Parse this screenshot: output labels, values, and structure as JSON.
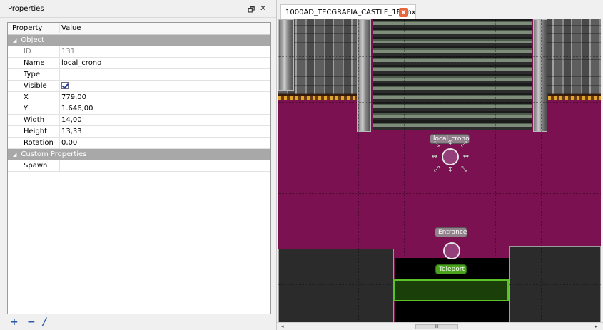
{
  "properties_panel": {
    "title": "Properties",
    "float_glyph": "🗗",
    "close_glyph": "✕",
    "header": {
      "property": "Property",
      "value": "Value"
    },
    "groups": {
      "object": "Object",
      "custom": "Custom Properties"
    },
    "rows": {
      "id": {
        "label": "ID",
        "value": "131"
      },
      "name": {
        "label": "Name",
        "value": "local_crono"
      },
      "type": {
        "label": "Type",
        "value": ""
      },
      "visible": {
        "label": "Visible",
        "checked": true
      },
      "x": {
        "label": "X",
        "value": "779,00"
      },
      "y": {
        "label": "Y",
        "value": "1.646,00"
      },
      "width": {
        "label": "Width",
        "value": "14,00"
      },
      "height": {
        "label": "Height",
        "value": "13,33"
      },
      "rotation": {
        "label": "Rotation",
        "value": "0,00"
      },
      "spawn": {
        "label": "Spawn",
        "value": ""
      }
    },
    "tools": {
      "add": "+",
      "remove": "−",
      "rename": "/"
    }
  },
  "editor": {
    "tab_label": "1000AD_TECGRAFIA_CASTLE_1F.tmx",
    "tab_close": "x",
    "objects": {
      "local_crono": "local_crono",
      "entrance": "Entrance",
      "teleport": "Teleport"
    },
    "scrollbar": {
      "left": "◂",
      "right": "▸",
      "thumb": "III"
    }
  },
  "colors": {
    "floor_carpet": "#7b1150",
    "teleport_green": "#4aa21c",
    "group_header": "#a8a8a8",
    "tab_close": "#e8663c"
  }
}
